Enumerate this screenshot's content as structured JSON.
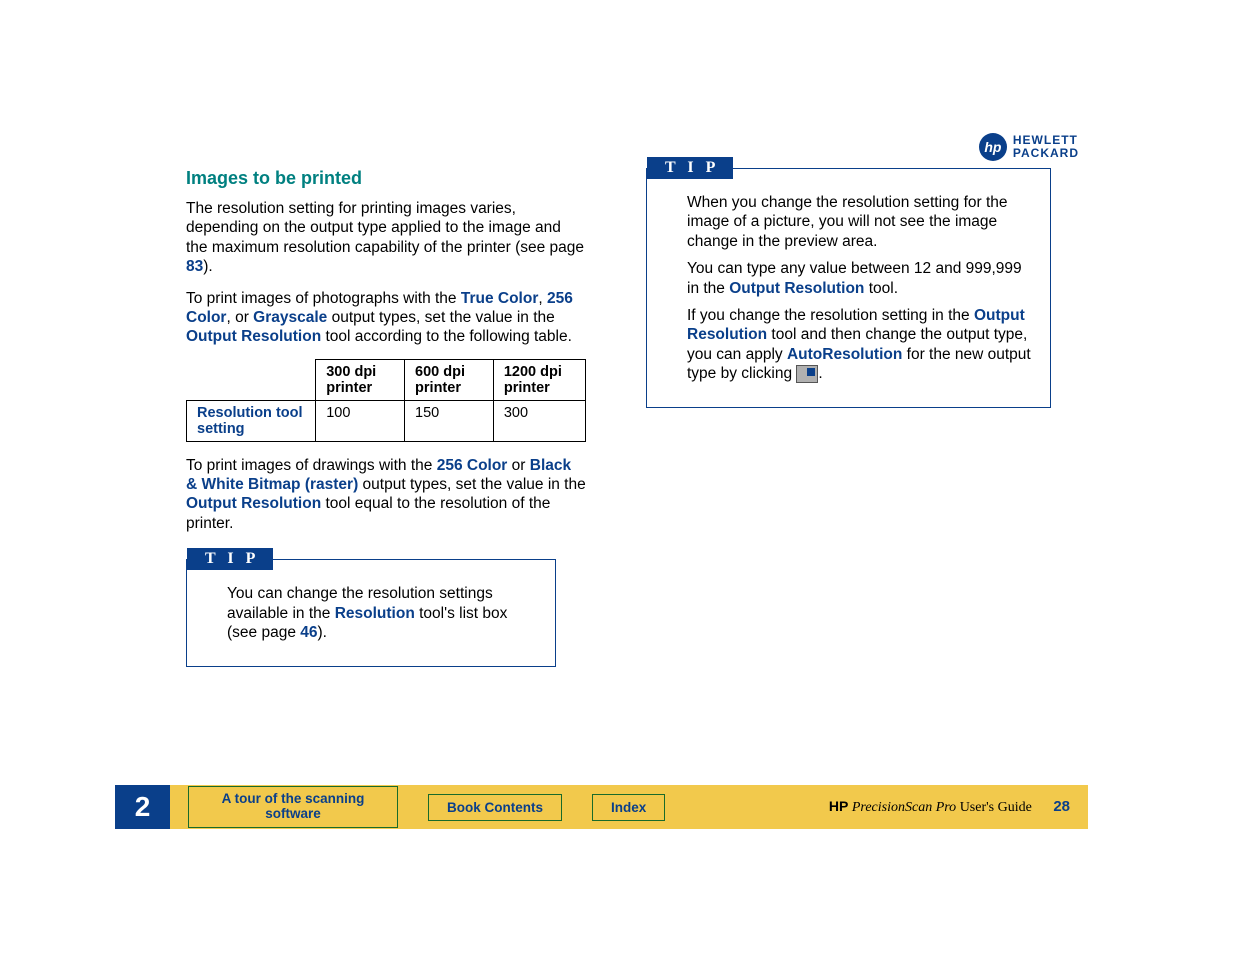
{
  "logo": {
    "brand1": "HEWLETT",
    "brand2": "PACKARD",
    "hp": "hp"
  },
  "heading": "Images to be printed",
  "p1_a": "The resolution setting for printing images varies, depending on the output type applied to the image and the maximum resolution capability of the printer (see page ",
  "p1_link": "83",
  "p1_b": ").",
  "p2_a": "To print images of photographs with the ",
  "p2_link1": "True Color",
  "p2_sep1": ", ",
  "p2_link2": "256 Color",
  "p2_sep2": ", or ",
  "p2_link3": "Grayscale",
  "p2_b": " output types, set the value in the ",
  "p2_link4": "Output Resolution",
  "p2_c": " tool according to the following table.",
  "table": {
    "h1": "300 dpi printer",
    "h2": "600 dpi printer",
    "h3": "1200 dpi printer",
    "rowhead": "Resolution tool setting",
    "c1": "100",
    "c2": "150",
    "c3": "300"
  },
  "p3_a": "To print images of drawings with the ",
  "p3_link1": "256 Color",
  "p3_sep": " or ",
  "p3_link2": "Black & White Bitmap (raster)",
  "p3_b": " output types, set the value in the ",
  "p3_link3": "Output Resolution",
  "p3_c": " tool equal to the resolution of the printer.",
  "tip_label": "T I P",
  "tip1_a": "You can change the resolution settings available in the ",
  "tip1_link": "Resolution",
  "tip1_b": " tool's list box (see page ",
  "tip1_page": "46",
  "tip1_c": ").",
  "tip2_p1": "When you change the resolution setting for the image of a picture, you will not see the image change in the preview area.",
  "tip2_p2_a": "You can type any value between 12 and 999,999 in the ",
  "tip2_p2_link": "Output Resolution",
  "tip2_p2_b": " tool.",
  "tip2_p3_a": "If you change the resolution setting in the ",
  "tip2_p3_link1": "Output Resolution",
  "tip2_p3_b": " tool and then change the output type, you can apply ",
  "tip2_p3_link2": "AutoResolution",
  "tip2_p3_c": " for the new output type by clicking ",
  "tip2_p3_d": ".",
  "footer": {
    "chapter": "2",
    "btn1": "A tour of the scanning software",
    "btn2": "Book Contents",
    "btn3": "Index",
    "hp": "HP",
    "psp": "PrecisionScan Pro",
    "guide": " User's Guide",
    "page": "28"
  }
}
